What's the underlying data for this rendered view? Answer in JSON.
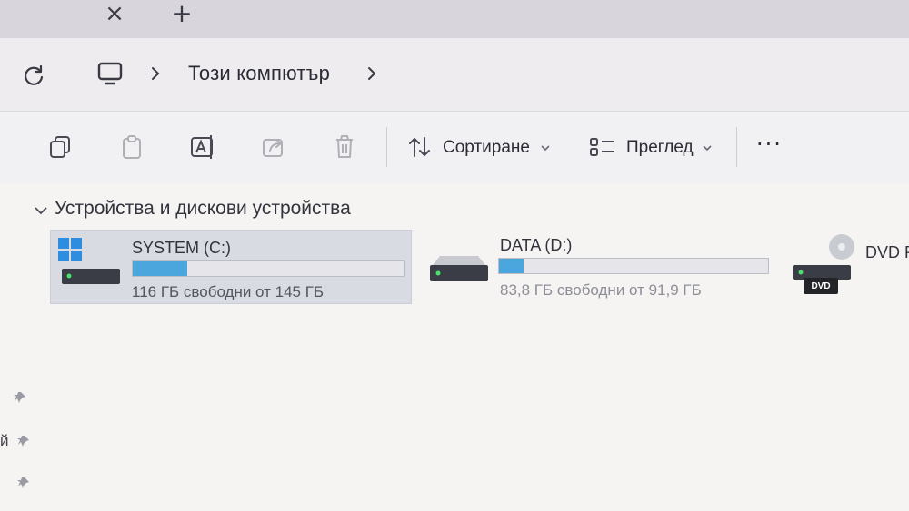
{
  "tabs": {
    "close_glyph": "×",
    "add_glyph": "+"
  },
  "address": {
    "location": "Този компютър"
  },
  "toolbar": {
    "sort_label": "Сортиране",
    "view_label": "Преглед",
    "more_label": "···",
    "icons": [
      "copy-icon",
      "paste-icon",
      "rename-icon",
      "share-icon",
      "delete-icon",
      "sort-icon",
      "view-icon"
    ]
  },
  "section": {
    "title": "Устройства и дискови устройства"
  },
  "drives": [
    {
      "name": "SYSTEM (C:)",
      "free_text": "116 ГБ свободни от 145 ГБ",
      "used_fraction": 0.2,
      "icon": "windows-drive-icon"
    },
    {
      "name": "DATA (D:)",
      "free_text": "83,8 ГБ свободни от 91,9 ГБ",
      "used_fraction": 0.09,
      "icon": "hard-drive-icon"
    },
    {
      "name": "DVD R",
      "badge": "DVD",
      "icon": "dvd-drive-icon"
    }
  ],
  "sidebar": {
    "fragment": "й"
  },
  "colors": {
    "accent": "#4aa6dc",
    "selected_tile": "#d9dbe3"
  }
}
